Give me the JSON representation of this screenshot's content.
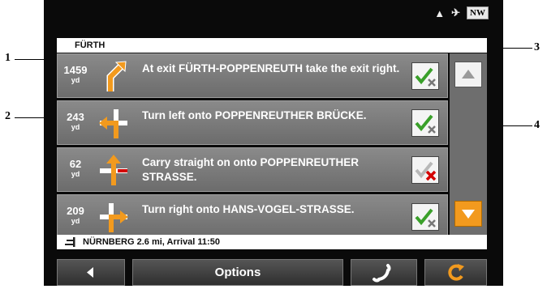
{
  "status": {
    "compass": "NW"
  },
  "route": {
    "city": "FÜRTH",
    "rows": [
      {
        "distance": "1459",
        "unit": "yd",
        "instruction": "At exit FÜRTH-POPPENREUTH take the exit right.",
        "icon": "exit-right-icon",
        "checked": true
      },
      {
        "distance": "243",
        "unit": "yd",
        "instruction": "Turn left onto POPPENREUTHER BRÜCKE.",
        "icon": "turn-left-icon",
        "checked": true
      },
      {
        "distance": "62",
        "unit": "yd",
        "instruction": "Carry straight on onto POPPENREUTHER STRASSE.",
        "icon": "straight-icon",
        "checked": false
      },
      {
        "distance": "209",
        "unit": "yd",
        "instruction": "Turn right onto HANS-VOGEL-STRASSE.",
        "icon": "turn-right-icon",
        "checked": true
      }
    ],
    "destination": "NÜRNBERG 2.6 mi, Arrival 11:50"
  },
  "buttons": {
    "options": "Options"
  },
  "callouts": [
    "1",
    "2",
    "3",
    "4"
  ],
  "colors": {
    "arrow": "#f29a1e",
    "red_x": "#d40000",
    "green_check": "#3aa02a"
  }
}
